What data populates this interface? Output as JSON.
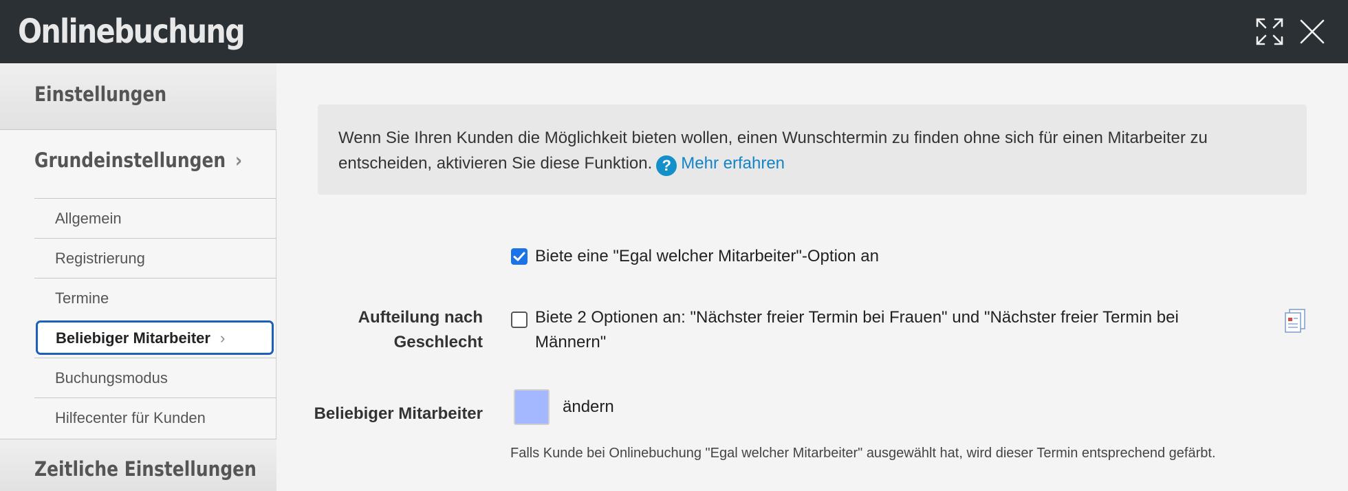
{
  "window": {
    "title": "Onlinebuchung",
    "icons": [
      "expand-icon",
      "close-icon"
    ]
  },
  "sidebar": {
    "section_top": "Einstellungen",
    "group": {
      "label": "Grundeinstellungen",
      "chevron": "›"
    },
    "items": [
      {
        "label": "Allgemein"
      },
      {
        "label": "Registrierung"
      },
      {
        "label": "Termine"
      },
      {
        "label": "Beliebiger Mitarbeiter",
        "chevron": "›",
        "active": true
      },
      {
        "label": "Buchungsmodus"
      },
      {
        "label": "Hilfecenter für Kunden"
      }
    ],
    "section_bottom": "Zeitliche Einstellungen"
  },
  "main": {
    "info": {
      "text": "Wenn Sie Ihren Kunden die Möglichkeit bieten wollen, einen Wunschtermin zu finden ohne sich für einen Mitarbeiter zu entscheiden, aktivieren Sie diese Funktion.",
      "help_glyph": "?",
      "more_link": "Mehr erfahren"
    },
    "option_any": {
      "label": "Biete eine \"Egal welcher Mitarbeiter\"-Option an",
      "checked": true
    },
    "gender_split": {
      "label_line1": "Aufteilung nach",
      "label_line2": "Geschlecht",
      "option_line1": "Biete 2 Optionen an: \"Nächster freier Termin bei Frauen\" und \"Nächster freier Termin bei",
      "option_line2": "Männern\"",
      "checked": false
    },
    "color_row": {
      "label": "Beliebiger Mitarbeiter",
      "swatch_color": "#a3b8ff",
      "change_label": "ändern",
      "hint": "Falls Kunde bei Onlinebuchung \"Egal welcher Mitarbeiter\" ausgewählt hat, wird dieser Termin entsprechend gefärbt."
    }
  },
  "colors": {
    "header_bg": "#2a3033",
    "accent": "#1a73e8",
    "link": "#1583c7",
    "active_border": "#1e5fb8"
  }
}
